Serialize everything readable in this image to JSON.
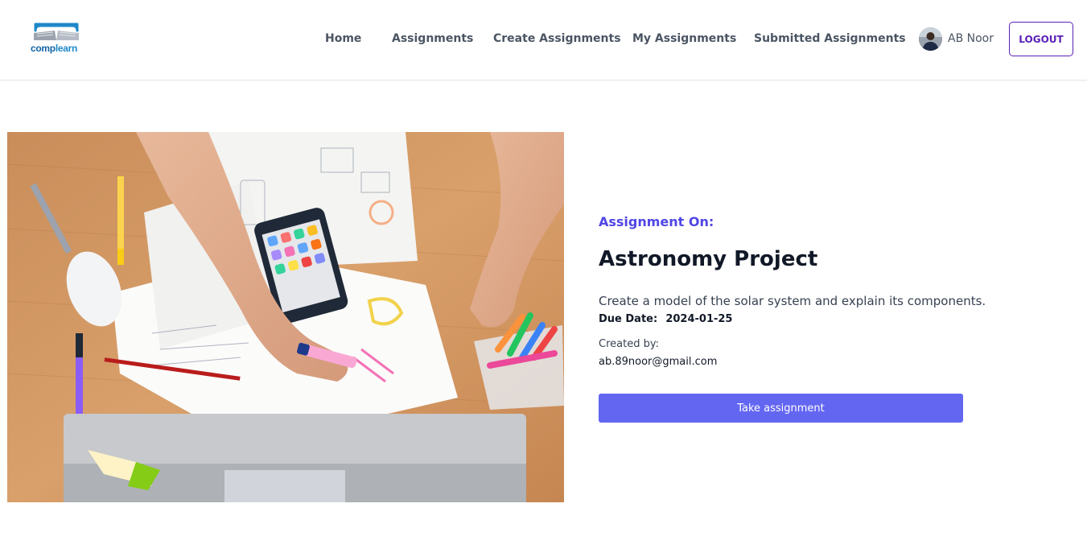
{
  "header": {
    "logo": {
      "text_part1": "comp",
      "text_part2": "learn",
      "icon": "open-book-icon"
    },
    "nav": [
      {
        "label": "Home"
      },
      {
        "label": "Assignments"
      },
      {
        "label": "Create Assignments"
      },
      {
        "label": "My Assignments"
      },
      {
        "label": "Submitted Assignments"
      }
    ],
    "user": {
      "name": "AB Noor",
      "avatar_icon": "user-avatar"
    },
    "logout_label": "LOGOUT"
  },
  "assignment": {
    "label": "Assignment On:",
    "title": "Astronomy Project",
    "description": "Create a model of the solar system and explain its components.",
    "due_label": "Due Date:",
    "due_date": "2024-01-25",
    "created_by_label": "Created by:",
    "created_by": "ab.89noor@gmail.com",
    "action_label": "Take assignment"
  },
  "colors": {
    "accent": "#5046e5",
    "button": "#6366f1",
    "logout_border": "#5b21b6",
    "logo_blue": "#1e88c9"
  }
}
